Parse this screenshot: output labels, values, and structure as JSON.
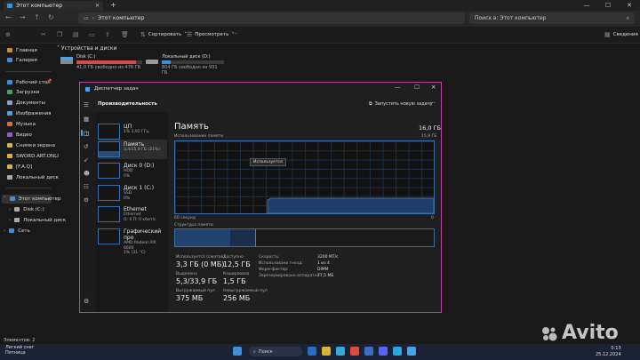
{
  "explorer": {
    "tab_title": "Этот компьютер",
    "address": "Этот компьютер",
    "search_placeholder": "Поиск в: Этот компьютер",
    "toolbar": {
      "sort": "Сортировать",
      "view": "Просмотреть",
      "details": "Сведения"
    },
    "sidebar": {
      "top": [
        "Главная",
        "Галерея"
      ],
      "quick": [
        "Рабочий стол",
        "Загрузки",
        "Документы",
        "Изображения",
        "Музыка",
        "Видео",
        "Снимки экрана",
        "SWORD.ART.ONLI",
        "[F.A.Q]",
        "Локальный диск"
      ],
      "tree": [
        "Этот компьютер",
        "Disk (C:)",
        "Локальный диск",
        "Сеть"
      ]
    },
    "drives_header": "Устройства и диски",
    "drives": [
      {
        "name": "Disk (C:)",
        "free": "41,0 ГБ свободно из 476 ГБ",
        "used_fraction": 0.91,
        "color": "#d14b4b"
      },
      {
        "name": "Локальный диск (D:)",
        "free": "804 ГБ свободно из 931 ГБ",
        "used_fraction": 0.14,
        "color": "#3c8fd8"
      }
    ],
    "status": "Элементов: 2"
  },
  "taskmanager": {
    "title": "Диспетчер задач",
    "section": "Производительность",
    "run_task": "Запустить новую задачу",
    "resources": [
      {
        "name": "ЦП",
        "sub": "1% 3,92 ГГц",
        "sub2": ""
      },
      {
        "name": "Память",
        "sub": "3,4/15,9 ГБ (21%)",
        "sub2": ""
      },
      {
        "name": "Диск 0 (D:)",
        "sub": "HDD",
        "sub2": "0%"
      },
      {
        "name": "Диск 1 (C:)",
        "sub": "SSD",
        "sub2": "0%"
      },
      {
        "name": "Ethernet",
        "sub": "Ethernet",
        "sub2": "О: 0 П: 0 кбит/с"
      },
      {
        "name": "Графический про",
        "sub": "AMD Radeon RX 6600",
        "sub2": "1% (31 °C)"
      }
    ],
    "memory": {
      "title": "Память",
      "total": "16,0 ГБ",
      "usage_label": "Использование памяти",
      "usage_max": "15,9 ГБ",
      "tooltip": "Используется",
      "time_label": "60 секунд",
      "zero": "0",
      "structure_label": "Структура памяти",
      "used_fraction": 0.21,
      "stats": [
        {
          "label": "Используется (сжатая)",
          "value": "3,3 ГБ (0 МБ)"
        },
        {
          "label": "Доступно",
          "value": "12,5 ГБ"
        },
        {
          "label": "Выделено",
          "value": "5,3/33,9 ГБ"
        },
        {
          "label": "Кэшировано",
          "value": "1,5 ГБ"
        },
        {
          "label": "Выгружаемый пул",
          "value": "375 МБ"
        },
        {
          "label": "Невыгружаемый пул",
          "value": "256 МБ"
        }
      ],
      "info": [
        {
          "k": "Скорость:",
          "v": "3200 МТ/с"
        },
        {
          "k": "Использовано гнезд:",
          "v": "1 из 4"
        },
        {
          "k": "Форм-фактор:",
          "v": "DIMM"
        },
        {
          "k": "Зарезервировано аппаратно:",
          "v": "77,5 МБ"
        }
      ]
    }
  },
  "taskbar": {
    "weather_line1": "Легкий снег",
    "weather_line2": "Пятница",
    "search": "Поиск",
    "time": "0:13",
    "date": "25.12.2024"
  },
  "watermark": "Avito"
}
